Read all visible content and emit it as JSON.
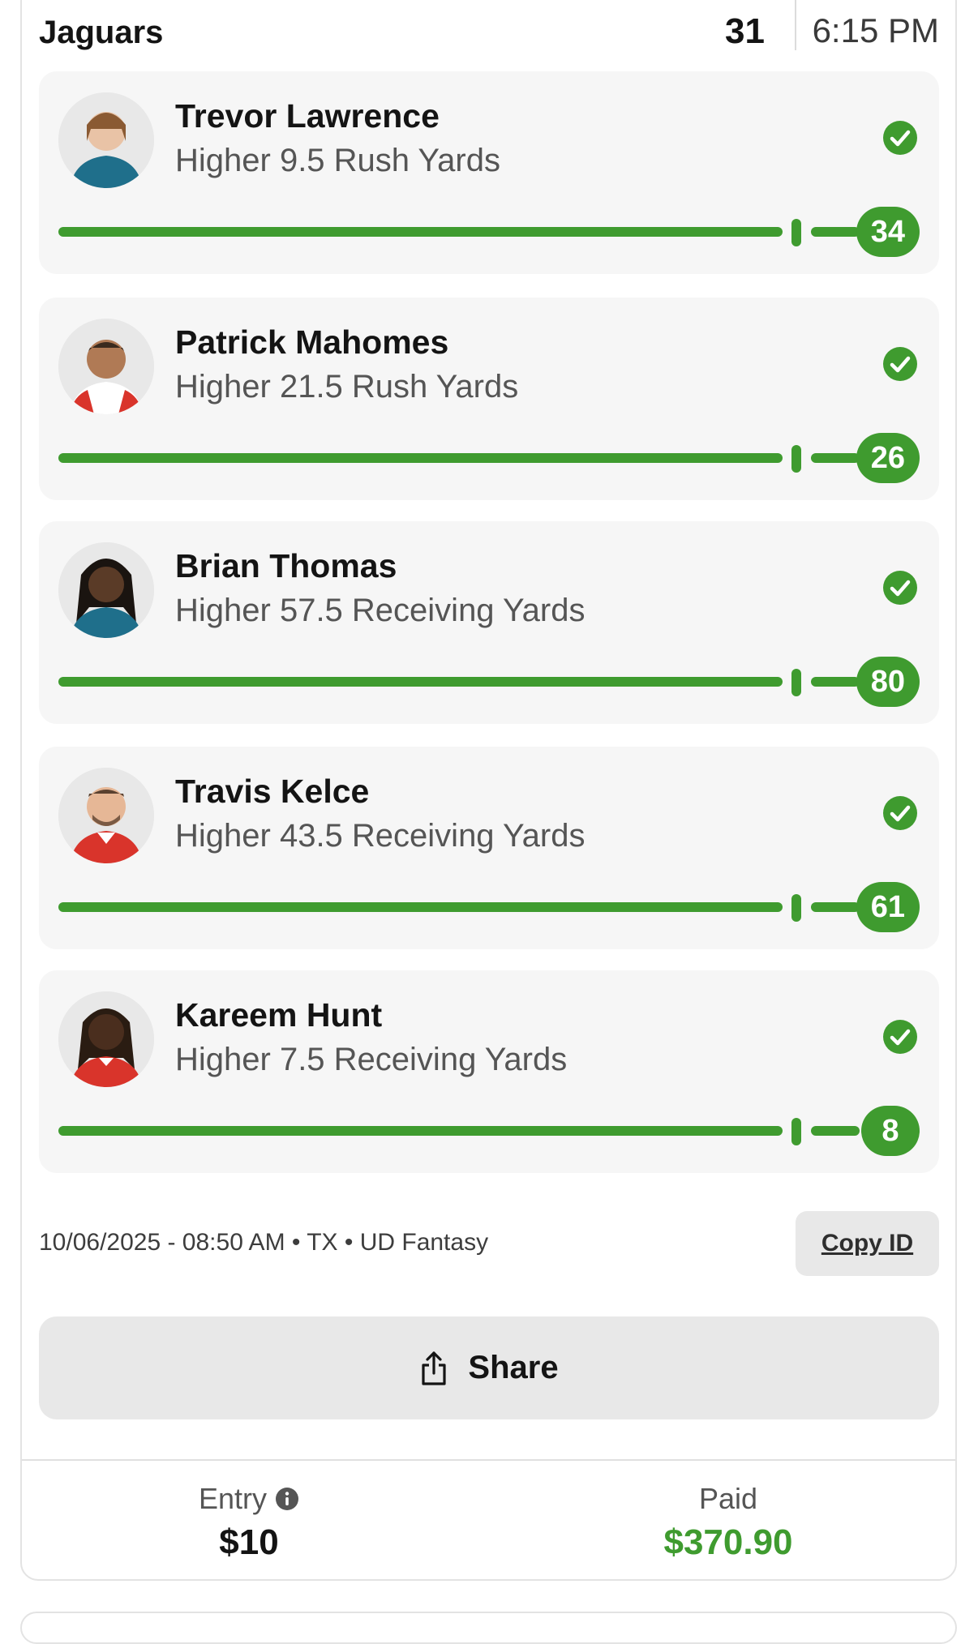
{
  "game_header": {
    "team": "Jaguars",
    "score": "31",
    "time": "6:15 PM"
  },
  "picks": [
    {
      "player": "Trevor Lawrence",
      "line": "Higher 9.5 Rush Yards",
      "result": "34",
      "status_icon": "check-circle-icon",
      "jersey_color": "#1f6f8b"
    },
    {
      "player": "Patrick Mahomes",
      "line": "Higher 21.5 Rush Yards",
      "result": "26",
      "status_icon": "check-circle-icon",
      "jersey_color": "#d9342b"
    },
    {
      "player": "Brian Thomas",
      "line": "Higher 57.5 Receiving Yards",
      "result": "80",
      "status_icon": "check-circle-icon",
      "jersey_color": "#1f6f8b"
    },
    {
      "player": "Travis Kelce",
      "line": "Higher 43.5 Receiving Yards",
      "result": "61",
      "status_icon": "check-circle-icon",
      "jersey_color": "#d9342b"
    },
    {
      "player": "Kareem Hunt",
      "line": "Higher 7.5 Receiving Yards",
      "result": "8",
      "status_icon": "check-circle-icon",
      "jersey_color": "#d9342b"
    }
  ],
  "meta": {
    "line": "10/06/2025 - 08:50 AM • TX • UD Fantasy",
    "copy_id_label": "Copy ID"
  },
  "share": {
    "label": "Share",
    "icon": "share-icon"
  },
  "footer": {
    "entry_label": "Entry",
    "entry_value": "$10",
    "paid_label": "Paid",
    "paid_value": "$370.90"
  },
  "colors": {
    "accent_green": "#3f9b2f",
    "card_bg": "#f6f6f6",
    "button_bg": "#e8e8e8"
  }
}
